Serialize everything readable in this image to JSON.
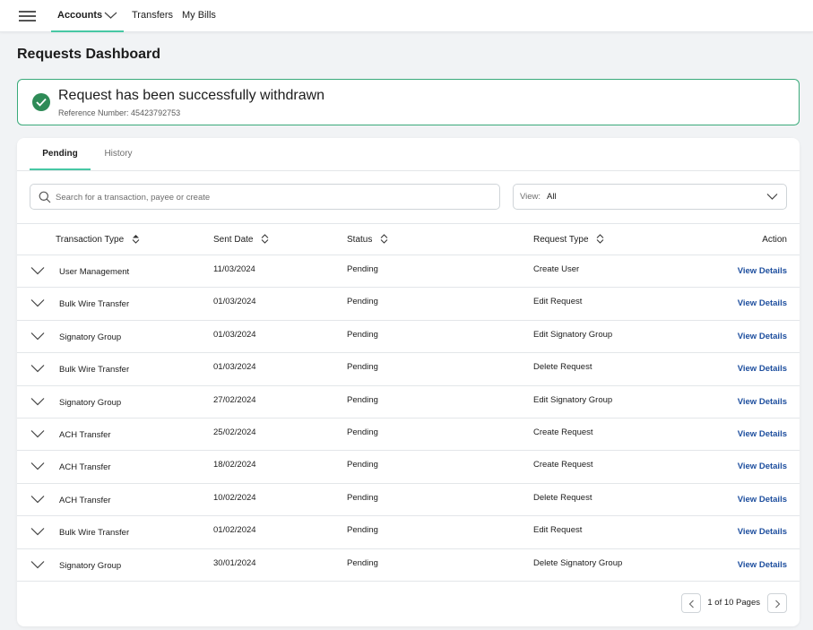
{
  "nav": {
    "items": [
      {
        "label": "Accounts"
      },
      {
        "label": "Transfers"
      },
      {
        "label": "My Bills"
      }
    ]
  },
  "page": {
    "title": "Requests Dashboard"
  },
  "alert": {
    "title": "Request has been successfully withdrawn",
    "reference": "Reference Number: 45423792753",
    "color": "#2e8b57"
  },
  "tabs": [
    {
      "label": "Pending"
    },
    {
      "label": "History"
    }
  ],
  "search": {
    "placeholder": "Search for a transaction, payee or create",
    "value": ""
  },
  "view": {
    "label": "View:",
    "value": "All"
  },
  "table": {
    "columns": [
      "Transaction Type",
      "Sent Date",
      "Status",
      "Request Type",
      "Action"
    ],
    "rows": [
      {
        "type": "User Management",
        "date": "11/03/2024",
        "status": "Pending",
        "request": "Create User",
        "action": "View Details"
      },
      {
        "type": "Bulk Wire Transfer",
        "date": "01/03/2024",
        "status": "Pending",
        "request": "Edit Request",
        "action": "View Details"
      },
      {
        "type": "Signatory Group",
        "date": "01/03/2024",
        "status": "Pending",
        "request": "Edit Signatory Group",
        "action": "View Details"
      },
      {
        "type": "Bulk Wire Transfer",
        "date": "01/03/2024",
        "status": "Pending",
        "request": "Delete Request",
        "action": "View Details"
      },
      {
        "type": "Signatory Group",
        "date": "27/02/2024",
        "status": "Pending",
        "request": "Edit Signatory Group",
        "action": "View Details"
      },
      {
        "type": "ACH Transfer",
        "date": "25/02/2024",
        "status": "Pending",
        "request": "Create Request",
        "action": "View Details"
      },
      {
        "type": "ACH Transfer",
        "date": "18/02/2024",
        "status": "Pending",
        "request": "Create Request",
        "action": "View Details"
      },
      {
        "type": "ACH Transfer",
        "date": "10/02/2024",
        "status": "Pending",
        "request": "Delete Request",
        "action": "View Details"
      },
      {
        "type": "Bulk Wire Transfer",
        "date": "01/02/2024",
        "status": "Pending",
        "request": "Edit Request",
        "action": "View Details"
      },
      {
        "type": "Signatory Group",
        "date": "30/01/2024",
        "status": "Pending",
        "request": "Delete Signatory Group",
        "action": "View Details"
      }
    ]
  },
  "pagination": {
    "text": "1 of 10 Pages"
  },
  "colors": {
    "accent": "#47c7a4",
    "link": "#1d4e9e"
  }
}
